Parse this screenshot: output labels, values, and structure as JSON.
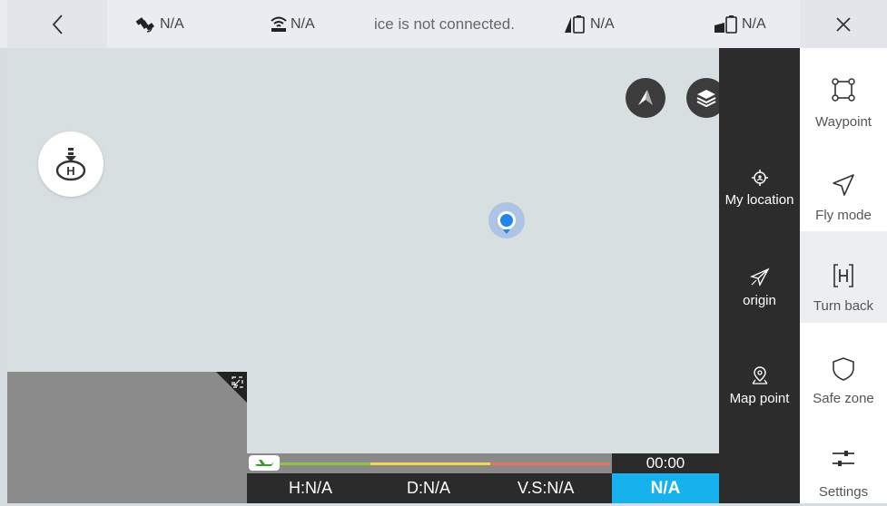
{
  "topbar": {
    "gps": {
      "icon": "satellite-icon",
      "value": "N/A"
    },
    "signal": {
      "icon": "signal-icon",
      "value": "N/A"
    },
    "message": "ice is not connected.",
    "drone_battery": {
      "icon": "drone-battery-icon",
      "value": "N/A"
    },
    "remote_battery": {
      "icon": "remote-battery-icon",
      "value": "N/A"
    }
  },
  "map_panel": {
    "my_location": "My location",
    "origin": "origin",
    "map_point": "Map point"
  },
  "sidebar": {
    "items": [
      {
        "label": "Waypoint",
        "icon": "waypoint-icon"
      },
      {
        "label": "Fly mode",
        "icon": "fly-mode-icon"
      },
      {
        "label": "Turn back",
        "icon": "turn-back-icon"
      },
      {
        "label": "Safe zone",
        "icon": "safe-zone-icon"
      },
      {
        "label": "Settings",
        "icon": "settings-icon"
      }
    ]
  },
  "telemetry": {
    "timer": "00:00",
    "height": "H:N/A",
    "distance": "D:N/A",
    "vertical_speed": "V.S:N/A",
    "mode": "N/A"
  },
  "colors": {
    "progress_green": "#8cc63f",
    "progress_yellow": "#f2d94e",
    "progress_red": "#e8735a",
    "mode_bg": "#16b2ee"
  }
}
